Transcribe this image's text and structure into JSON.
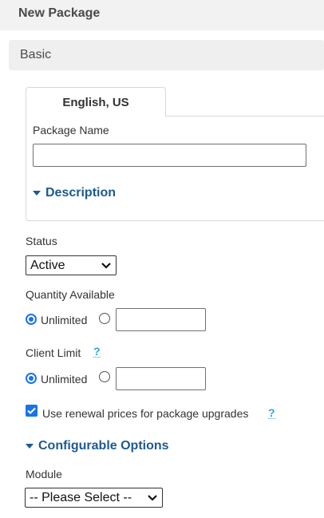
{
  "header": {
    "title": "New Package"
  },
  "section": {
    "title": "Basic"
  },
  "language_tab": {
    "label": "English, US"
  },
  "package_name": {
    "label": "Package Name",
    "value": ""
  },
  "description": {
    "label": "Description"
  },
  "status": {
    "label": "Status",
    "selected": "Active"
  },
  "quantity": {
    "label": "Quantity Available",
    "unlimited_label": "Unlimited",
    "unlimited_checked": true,
    "value": ""
  },
  "client_limit": {
    "label": "Client Limit",
    "help_symbol": "?",
    "unlimited_label": "Unlimited",
    "unlimited_checked": true,
    "value": ""
  },
  "renewal": {
    "label": "Use renewal prices for package upgrades",
    "checked": true,
    "help_symbol": "?"
  },
  "configurable_options": {
    "label": "Configurable Options"
  },
  "module": {
    "label": "Module",
    "selected": "-- Please Select --"
  },
  "colors": {
    "accent": "#1a73e8",
    "heading": "#1d5a8e",
    "help": "#36a3d9"
  }
}
